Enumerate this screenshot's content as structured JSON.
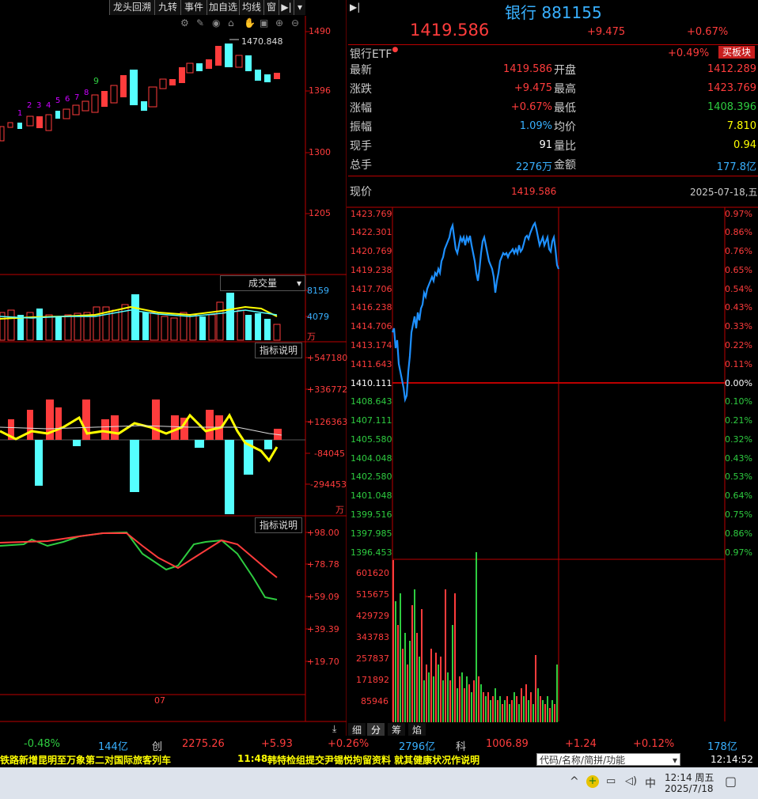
{
  "toolbar": {
    "items": [
      "龙头回溯",
      "九转",
      "事件",
      "加自选",
      "均线",
      "窗"
    ],
    "arrow": "▶|",
    "dropdown": "▾"
  },
  "kline": {
    "price_ticks": [
      "1490",
      "1396",
      "1300",
      "1205"
    ],
    "high_label": "1470.848",
    "nine_turn_labels": [
      "1",
      "2",
      "3",
      "4",
      "5",
      "6",
      "7",
      "8",
      "9"
    ],
    "volume_title": "成交量",
    "volume_ticks": [
      "8159",
      "4079",
      "万"
    ],
    "indicator_button_1": "指标说明",
    "macd_ticks": [
      "+547180",
      "+336772",
      "+126363",
      "-84045",
      "-294453",
      "万"
    ],
    "indicator_button_2": "指标说明",
    "kdj_ticks": [
      "+98.00",
      "+78.78",
      "+59.09",
      "+39.39",
      "+19.70"
    ],
    "date_label": "07"
  },
  "header": {
    "name": "银行 881155",
    "price": "1419.586",
    "change": "+9.475",
    "change_pct": "+0.67%",
    "etf_label": "银行ETF",
    "etf_pct": "+0.49%",
    "buy_button": "买板块"
  },
  "quote": {
    "rows": [
      {
        "l1": "最新",
        "v1": "1419.586",
        "c1": "red",
        "l2": "开盘",
        "v2": "1412.289",
        "c2": "red"
      },
      {
        "l1": "涨跌",
        "v1": "+9.475",
        "c1": "red",
        "l2": "最高",
        "v2": "1423.769",
        "c2": "red"
      },
      {
        "l1": "涨幅",
        "v1": "+0.67%",
        "c1": "red",
        "l2": "最低",
        "v2": "1408.396",
        "c2": "green"
      },
      {
        "l1": "振幅",
        "v1": "1.09%",
        "c1": "cyan",
        "l2": "均价",
        "v2": "7.810",
        "c2": "yellow"
      },
      {
        "l1": "现手",
        "v1": "91",
        "c1": "white",
        "l2": "量比",
        "v2": "0.94",
        "c2": "yellow"
      },
      {
        "l1": "总手",
        "v1": "2276万",
        "c1": "cyan",
        "l2": "金额",
        "v2": "177.8亿",
        "c2": "cyan"
      }
    ]
  },
  "intraday": {
    "label": "现价",
    "price": "1419.586",
    "date": "2025-07-18,五",
    "left_ticks": [
      "1423.769",
      "1422.301",
      "1420.769",
      "1419.238",
      "1417.706",
      "1416.238",
      "1414.706",
      "1413.174",
      "1411.643",
      "1410.111",
      "1408.643",
      "1407.111",
      "1405.580",
      "1404.048",
      "1402.580",
      "1401.048",
      "1399.516",
      "1397.985",
      "1396.453"
    ],
    "right_ticks": [
      "0.97%",
      "0.86%",
      "0.76%",
      "0.65%",
      "0.54%",
      "0.43%",
      "0.33%",
      "0.22%",
      "0.11%",
      "0.00%",
      "0.10%",
      "0.21%",
      "0.32%",
      "0.43%",
      "0.53%",
      "0.64%",
      "0.75%",
      "0.86%",
      "0.97%"
    ],
    "vol_ticks": [
      "601620",
      "515675",
      "429729",
      "343783",
      "257837",
      "171892",
      "85946"
    ],
    "tabs": [
      "细",
      "分",
      "筹",
      "焰"
    ]
  },
  "status": {
    "pct1": "-0.48%",
    "amt1": "144亿",
    "idx2_label": "创",
    "idx2_val": "2275.26",
    "idx2_chg": "+5.93",
    "idx2_pct": "+0.26%",
    "amt2": "2796亿",
    "idx3_label": "科",
    "idx3_val": "1006.89",
    "idx3_chg": "+1.24",
    "idx3_pct": "+0.12%",
    "amt3": "178亿"
  },
  "ticker": {
    "news1": "铁路新增昆明至万象第二对国际旅客列车",
    "news2_time": "11:48",
    "news2": "韩特检组提交尹锡悦拘留资料 就其健康状况作说明",
    "search_placeholder": "代码/名称/简拼/功能",
    "clock": "12:14:52"
  },
  "taskbar": {
    "ime": "中",
    "time": "12:14 周五",
    "date": "2025/7/18"
  }
}
